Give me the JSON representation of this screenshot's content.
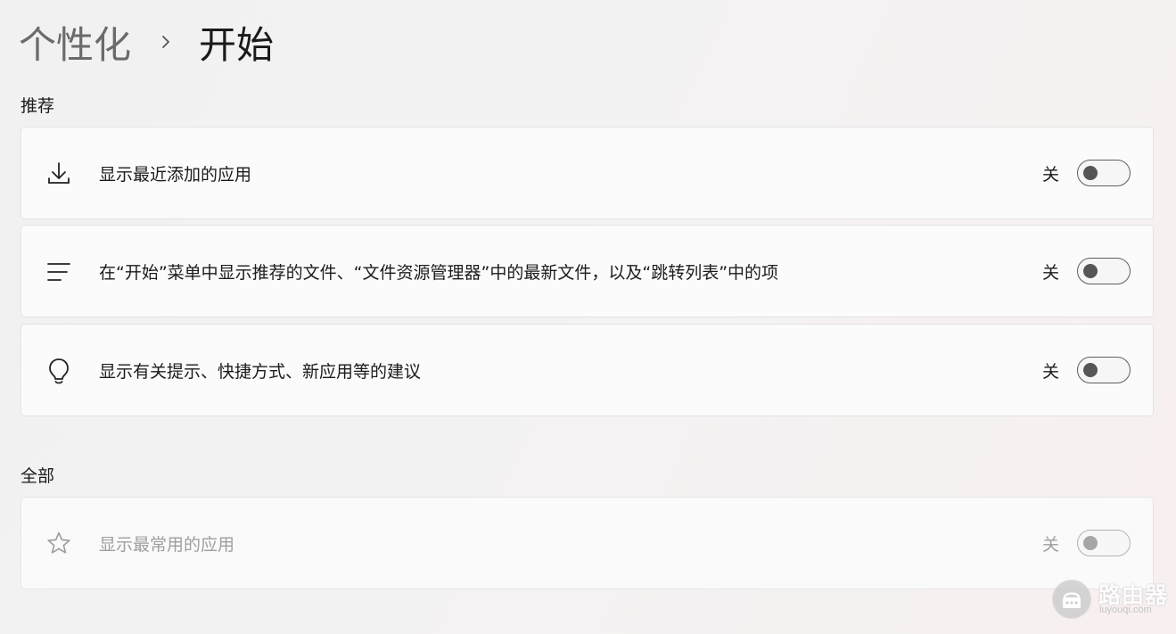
{
  "breadcrumb": {
    "parent": "个性化",
    "current": "开始"
  },
  "sections": {
    "recommended": {
      "title": "推荐",
      "items": [
        {
          "label": "显示最近添加的应用",
          "state": "关",
          "icon": "download-icon"
        },
        {
          "label": "在“开始”菜单中显示推荐的文件、“文件资源管理器”中的最新文件，以及“跳转列表”中的项",
          "state": "关",
          "icon": "list-icon"
        },
        {
          "label": "显示有关提示、快捷方式、新应用等的建议",
          "state": "关",
          "icon": "lightbulb-icon"
        }
      ]
    },
    "all": {
      "title": "全部",
      "items": [
        {
          "label": "显示最常用的应用",
          "state": "关",
          "icon": "star-icon",
          "disabled": true
        }
      ]
    }
  },
  "watermark": {
    "text": "路由器",
    "url": "luyouqi.com"
  }
}
